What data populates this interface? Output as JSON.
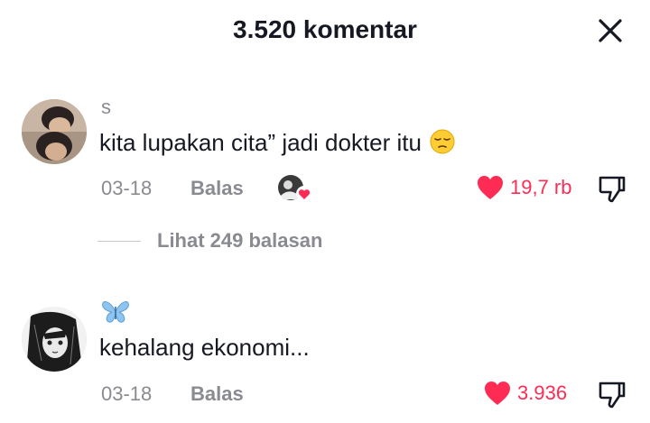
{
  "header": {
    "title": "3.520 komentar",
    "close_icon": "close-icon"
  },
  "comments": [
    {
      "username": "s",
      "text": "kita lupakan cita” jadi dokter itu",
      "emoji": "pensive-face",
      "date": "03-18",
      "reply_label": "Balas",
      "likes": "19,7 rb",
      "creator_liked": true,
      "replies_label": "Lihat 249 balasan"
    },
    {
      "username_icon": "butterfly-icon",
      "text": "kehalang ekonomi...",
      "date": "03-18",
      "reply_label": "Balas",
      "likes": "3.936"
    }
  ],
  "colors": {
    "like": "#fe2c55",
    "muted": "#8a8b91",
    "text": "#161823"
  }
}
